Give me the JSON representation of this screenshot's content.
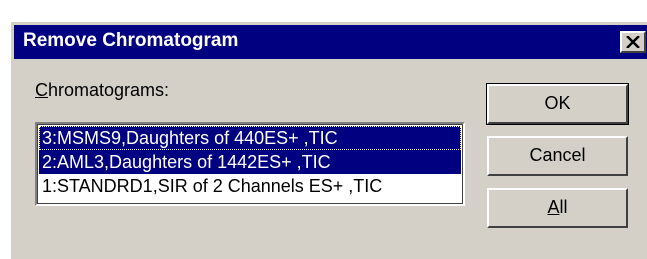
{
  "dialog": {
    "title": "Remove Chromatogram",
    "close_glyph": "close-icon"
  },
  "chromatograms": {
    "label_first": "C",
    "label_rest": "hromatograms:",
    "items": [
      {
        "text": "3:MSMS9,Daughters of 440ES+ ,TIC",
        "selected": true,
        "focused": true
      },
      {
        "text": "2:AML3,Daughters of 1442ES+ ,TIC",
        "selected": true,
        "focused": false
      },
      {
        "text": "1:STANDRD1,SIR of 2 Channels ES+ ,TIC",
        "selected": false,
        "focused": false
      }
    ]
  },
  "buttons": {
    "ok": "OK",
    "cancel": "Cancel",
    "all_first": "A",
    "all_rest": "ll"
  },
  "colors": {
    "titlebar": "#000080",
    "dialog_bg": "#d4d0c8",
    "selection": "#000080"
  }
}
